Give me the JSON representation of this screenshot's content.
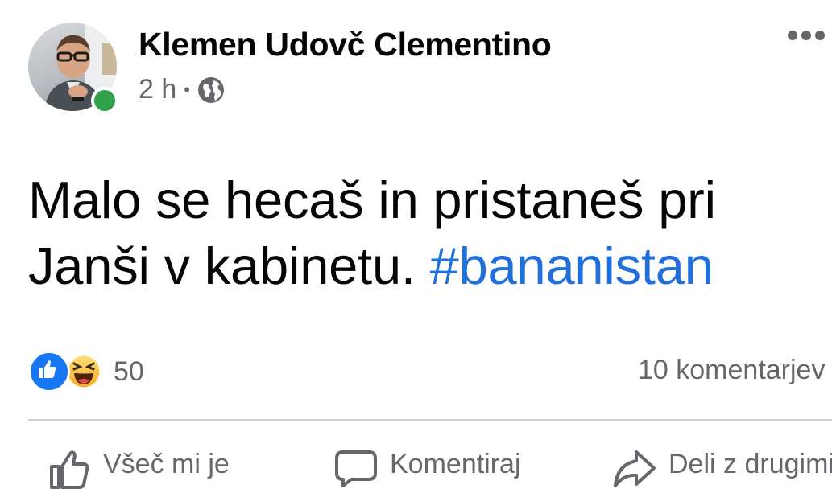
{
  "post": {
    "author": "Klemen Udovč Clementino",
    "time": "2 h",
    "separator": "•",
    "text_main": "Malo se hecaš in pristaneš pri Janši v kabinetu. ",
    "hashtag": "#bananistan",
    "reaction_count": "50",
    "comments_count": "10 komentarjev",
    "actions": {
      "like": "Všeč mi je",
      "comment": "Komentiraj",
      "share": "Deli z drugimi"
    }
  },
  "colors": {
    "hashtag": "#216fdb",
    "online": "#31a24c",
    "like_blue": "#1877f2",
    "secondary_text": "#65676b"
  },
  "icons": [
    "globe-icon",
    "more-options-icon",
    "like-reaction-icon",
    "haha-reaction-icon",
    "thumb-up-icon",
    "comment-icon",
    "share-icon"
  ]
}
